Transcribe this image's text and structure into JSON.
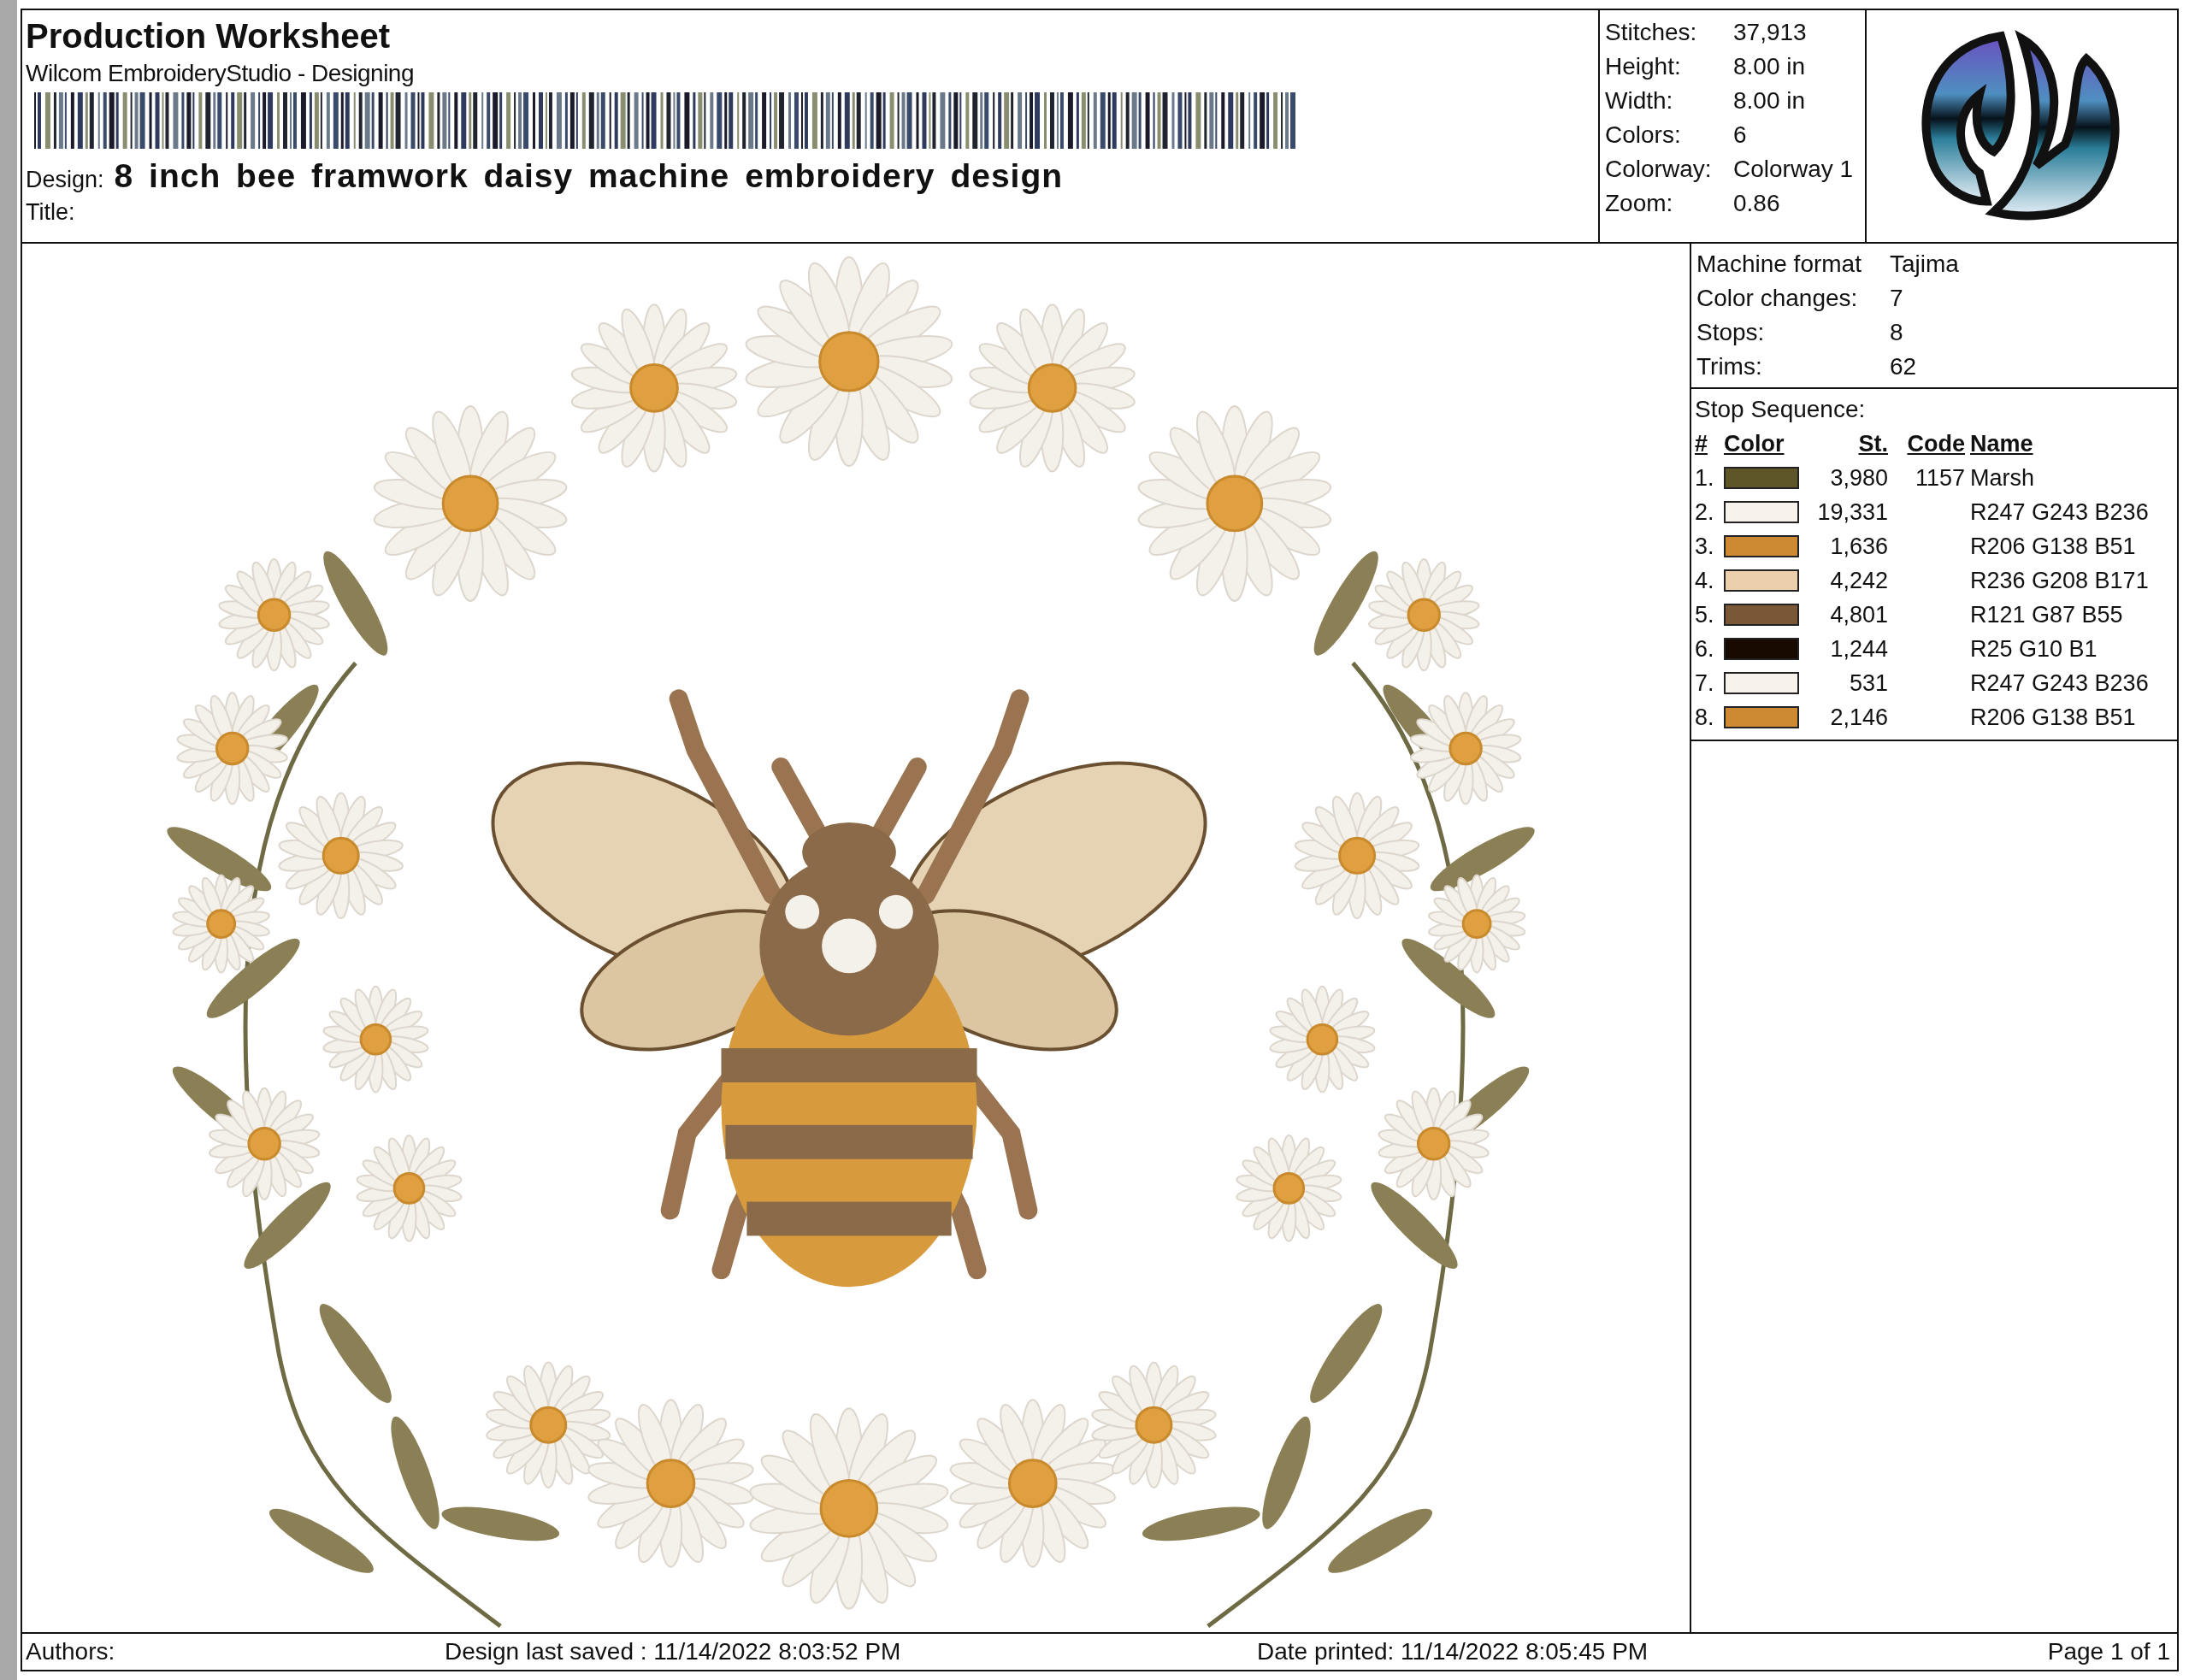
{
  "header": {
    "title": "Production Worksheet",
    "subtitle": "Wilcom EmbroideryStudio - Designing",
    "design_label": "Design:",
    "design_name": "8 inch bee framwork daisy machine embroidery design",
    "title_label": "Title:"
  },
  "stats": [
    {
      "label": "Stitches:",
      "value": "37,913"
    },
    {
      "label": "Height:",
      "value": "8.00 in"
    },
    {
      "label": "Width:",
      "value": "8.00 in"
    },
    {
      "label": "Colors:",
      "value": "6"
    },
    {
      "label": "Colorway:",
      "value": "Colorway 1"
    },
    {
      "label": "Zoom:",
      "value": "0.86"
    }
  ],
  "machine": [
    {
      "label": "Machine format",
      "value": "Tajima"
    },
    {
      "label": "Color changes:",
      "value": "7"
    },
    {
      "label": "Stops:",
      "value": "8"
    },
    {
      "label": "Trims:",
      "value": "62"
    }
  ],
  "stop_sequence": {
    "heading": "Stop Sequence:",
    "columns": [
      "#",
      "Color",
      "St.",
      "Code",
      "Name"
    ],
    "rows": [
      {
        "index": "1.",
        "color": "#5e5528",
        "stitches": "3,980",
        "code": "1157",
        "name": "Marsh"
      },
      {
        "index": "2.",
        "color": "#f7f3ec",
        "stitches": "19,331",
        "name": "R247 G243 B236"
      },
      {
        "index": "3.",
        "color": "#ce8a33",
        "stitches": "1,636",
        "name": "R206 G138 B51"
      },
      {
        "index": "4.",
        "color": "#ecd0ab",
        "stitches": "4,242",
        "name": "R236 G208 B171"
      },
      {
        "index": "5.",
        "color": "#795737",
        "stitches": "4,801",
        "name": "R121 G87 B55"
      },
      {
        "index": "6.",
        "color": "#190a01",
        "stitches": "1,244",
        "name": "R25 G10 B1"
      },
      {
        "index": "7.",
        "color": "#f7f3ec",
        "stitches": "531",
        "name": "R247 G243 B236"
      },
      {
        "index": "8.",
        "color": "#ce8a33",
        "stitches": "2,146",
        "name": "R206 G138 B51"
      }
    ]
  },
  "footer": {
    "authors": "Authors:",
    "saved": "Design last saved : 11/14/2022 8:03:52 PM",
    "printed": "Date printed: 11/14/2022 8:05:45 PM",
    "page": "Page 1 of 1"
  }
}
